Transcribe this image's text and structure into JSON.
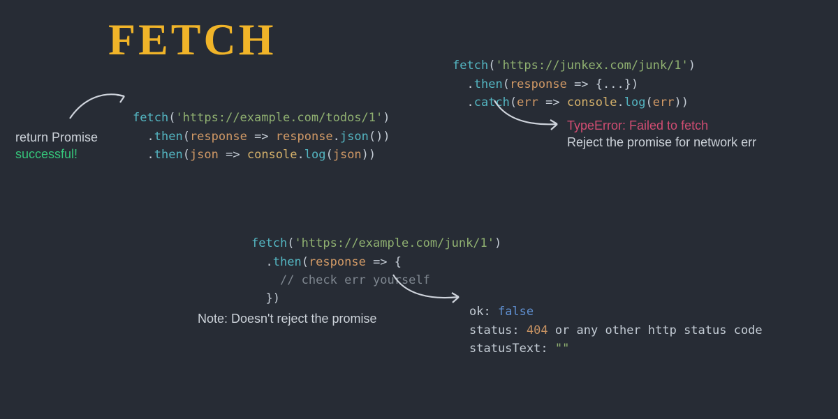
{
  "title": "FETCH",
  "block1": {
    "l1": {
      "fn": "fetch",
      "open": "(",
      "str": "'https://example.com/todos/1'",
      "close": ")"
    },
    "l2": {
      "dot": ".",
      "method": "then",
      "open": "(",
      "arg": "response",
      "arrow": " => ",
      "arg2": "response",
      "dot2": ".",
      "call": "json",
      "parens": "()",
      "close": ")"
    },
    "l3": {
      "dot": ".",
      "method": "then",
      "open": "(",
      "arg": "json",
      "arrow": " => ",
      "obj": "console",
      "dot2": ".",
      "call": "log",
      "open2": "(",
      "arg2": "json",
      "close2": ")",
      "close": ")"
    }
  },
  "anno1": {
    "line1": "return Promise",
    "line2": "successful!"
  },
  "block2": {
    "l1": {
      "fn": "fetch",
      "open": "(",
      "str": "'https://junkex.com/junk/1'",
      "close": ")"
    },
    "l2": {
      "dot": ".",
      "method": "then",
      "open": "(",
      "arg": "response",
      "arrow": " => ",
      "braces": "{...}",
      "close": ")"
    },
    "l3": {
      "dot": ".",
      "method": "catch",
      "open": "(",
      "arg": "err",
      "arrow": " => ",
      "obj": "console",
      "dot2": ".",
      "call": "log",
      "open2": "(",
      "arg2": "err",
      "close2": ")",
      "close": ")"
    }
  },
  "anno2": {
    "line1": "TypeError: Failed to fetch",
    "line2": "Reject the promise for network err"
  },
  "block3": {
    "l1": {
      "fn": "fetch",
      "open": "(",
      "str": "'https://example.com/junk/1'",
      "close": ")"
    },
    "l2": {
      "dot": ".",
      "method": "then",
      "open": "(",
      "arg": "response",
      "arrow": " => ",
      "brace": "{"
    },
    "l3": {
      "comment": "// check err yourself"
    },
    "l4": {
      "brace": "}",
      "close": ")"
    }
  },
  "anno3": "Note: Doesn't reject the promise",
  "status": {
    "ok_label": "ok: ",
    "ok_val": "false",
    "status_label": "status: ",
    "status_val": "404",
    "status_rest": " or any other http status code",
    "st_label": "statusText: ",
    "st_val": "\"\""
  }
}
